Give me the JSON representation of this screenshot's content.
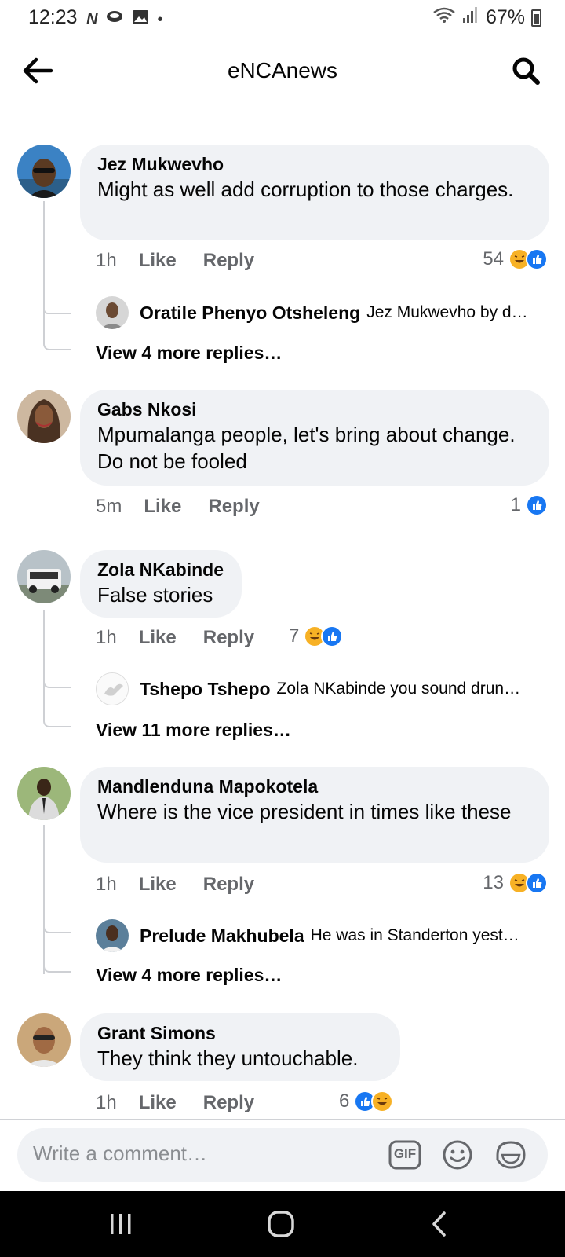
{
  "status_bar": {
    "time": "12:23",
    "battery": "67%"
  },
  "header": {
    "title": "eNCAnews"
  },
  "comments": [
    {
      "author": "Jez Mukwevho",
      "text": "Might as well add corruption to those charges.",
      "time": "1h",
      "like_label": "Like",
      "reply_label": "Reply",
      "reaction_count": "54",
      "reply_preview": {
        "author": "Oratile Phenyo Otsheleng",
        "snippet": "Jez Mukwevho by d…"
      },
      "view_more": "View 4 more replies…"
    },
    {
      "author": "Gabs Nkosi",
      "text": "Mpumalanga people, let's bring about change. Do not be fooled",
      "time": "5m",
      "like_label": "Like",
      "reply_label": "Reply",
      "reaction_count": "1"
    },
    {
      "author": "Zola NKabinde",
      "text": "False stories",
      "time": "1h",
      "like_label": "Like",
      "reply_label": "Reply",
      "reaction_count": "7",
      "reply_preview": {
        "author": "Tshepo Tshepo",
        "snippet": "Zola NKabinde you sound drun…"
      },
      "view_more": "View 11 more replies…"
    },
    {
      "author": "Mandlenduna Mapokotela",
      "text": "Where is the vice president in times like these",
      "time": "1h",
      "like_label": "Like",
      "reply_label": "Reply",
      "reaction_count": "13",
      "reply_preview": {
        "author": "Prelude Makhubela",
        "snippet": "He was in Standerton yest…"
      },
      "view_more": "View 4 more replies…"
    },
    {
      "author": "Grant Simons",
      "text": "They think they untouchable.",
      "time": "1h",
      "like_label": "Like",
      "reply_label": "Reply",
      "reaction_count": "6"
    }
  ],
  "composer": {
    "placeholder": "Write a comment…",
    "gif_label": "GIF"
  },
  "icons": {
    "back": "arrow-left-icon",
    "search": "search-icon",
    "haha": "haha-reaction-icon",
    "like": "like-reaction-icon",
    "emoji": "emoji-icon",
    "sticker": "sticker-icon"
  },
  "colors": {
    "bubble": "#f0f2f5",
    "like_blue": "#1877f2",
    "haha_yellow": "#f7b125",
    "meta_gray": "#65676b"
  }
}
